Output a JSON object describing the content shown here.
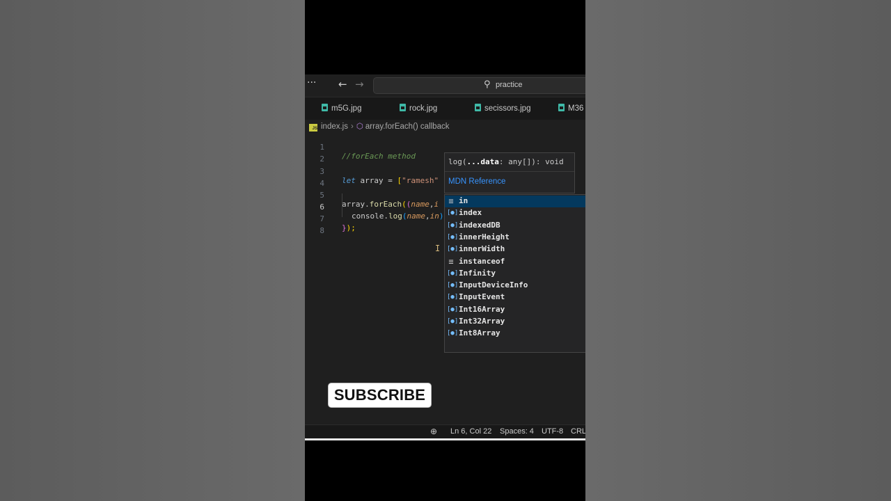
{
  "titlebar": {
    "menu_glyph": "···",
    "search_text": "practice"
  },
  "tabs": [
    {
      "label": "m5G.jpg"
    },
    {
      "label": "rock.jpg"
    },
    {
      "label": "secissors.jpg"
    },
    {
      "label": "M36"
    }
  ],
  "breadcrumb": {
    "file": "index.js",
    "symbol": "array.forEach() callback"
  },
  "code": {
    "line_numbers": [
      "1",
      "2",
      "3",
      "4",
      "5",
      "6",
      "7",
      "8"
    ],
    "l1_comment": "//forEach method",
    "l3_kw": "let",
    "l3_var": " array ",
    "l3_eq": "= ",
    "l3_bracket": "[",
    "l3_str": "\"ramesh\"",
    "l5_obj": "array.",
    "l5_fn": "forEach",
    "l5_open": "(",
    "l5_paren": "(",
    "l5_param": "name",
    "l5_comma": ",",
    "l5_cut": "i",
    "l6_obj": "console.",
    "l6_fn": "log",
    "l6_open": "(",
    "l6_param": "name",
    "l6_comma": ",",
    "l6_typed": "in",
    "l6_close": ");",
    "l7_brace": "}",
    "l7_close": ");"
  },
  "hover": {
    "sig_pre": "log(",
    "sig_bold": "...data",
    "sig_post": ": any[]): void",
    "mdn_link": "MDN Reference"
  },
  "suggestions": [
    {
      "label": "in",
      "kind": "keyword",
      "selected": true
    },
    {
      "label": "index",
      "kind": "variable"
    },
    {
      "label": "indexedDB",
      "kind": "variable"
    },
    {
      "label": "innerHeight",
      "kind": "variable"
    },
    {
      "label": "innerWidth",
      "kind": "variable"
    },
    {
      "label": "instanceof",
      "kind": "keyword"
    },
    {
      "label": "Infinity",
      "kind": "variable"
    },
    {
      "label": "InputDeviceInfo",
      "kind": "variable"
    },
    {
      "label": "InputEvent",
      "kind": "variable"
    },
    {
      "label": "Int16Array",
      "kind": "variable"
    },
    {
      "label": "Int32Array",
      "kind": "variable"
    },
    {
      "label": "Int8Array",
      "kind": "variable"
    }
  ],
  "kind_glyphs": {
    "keyword": "≡",
    "variable": "[●]"
  },
  "overlay": {
    "subscribe": "SUBSCRIBE"
  },
  "statusbar": {
    "position": "Ln 6, Col 22",
    "indent": "Spaces: 4",
    "encoding": "UTF-8",
    "eol": "CRLF"
  },
  "colors": {
    "accent": "#3794ff",
    "selection": "#04395e",
    "file_icon": "#3fb9a7"
  }
}
